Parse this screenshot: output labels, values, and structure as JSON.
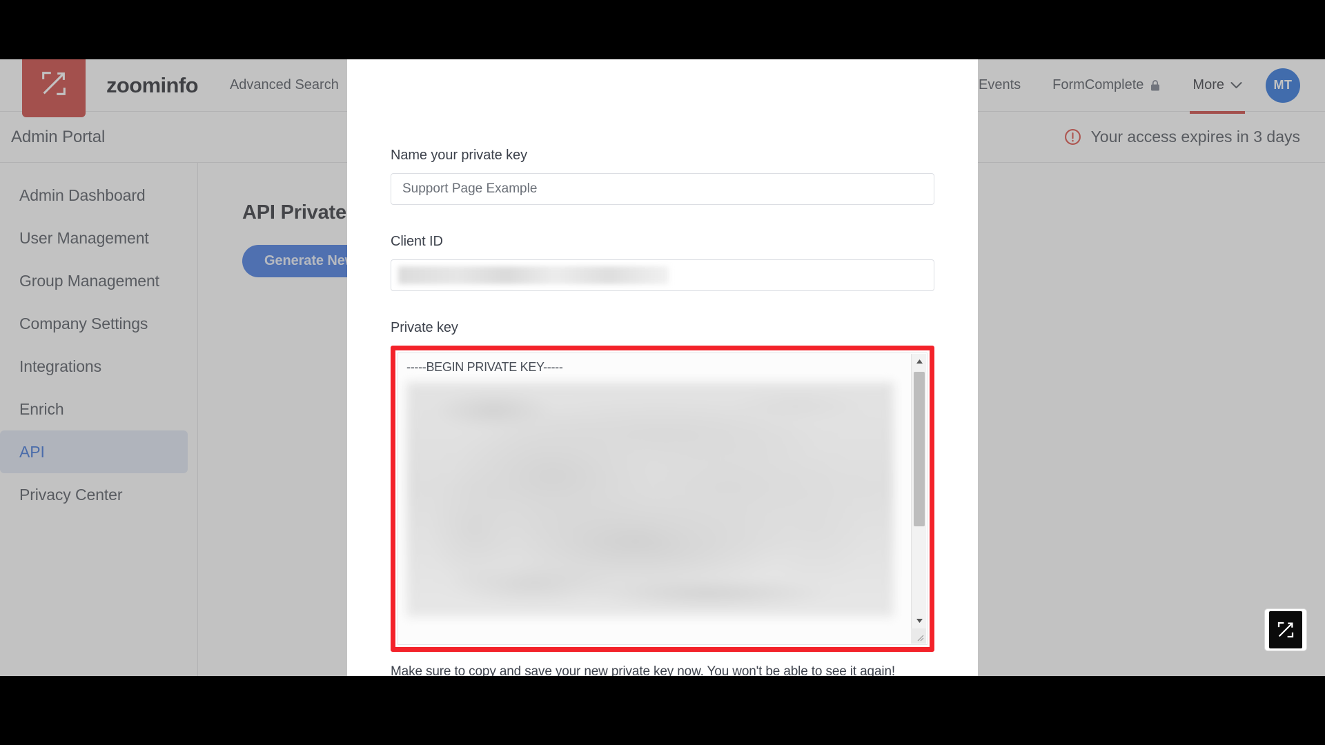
{
  "app": {
    "brand": "zoominfo",
    "logo_icon": "zoominfo-z-logo"
  },
  "topnav": {
    "links": [
      {
        "label": "Advanced Search",
        "icon": null,
        "active": false
      },
      {
        "label": "Events",
        "icon": null,
        "active": false
      },
      {
        "label": "FormComplete",
        "icon": "lock-icon",
        "active": false
      },
      {
        "label": "More",
        "icon": "chevron-down-icon",
        "active": true
      }
    ],
    "avatar_initials": "MT"
  },
  "portalbar": {
    "title": "Admin Portal",
    "expiry_icon": "alert-circle-icon",
    "expiry_text": "Your access expires in 3 days"
  },
  "sidebar": {
    "items": [
      {
        "label": "Admin Dashboard",
        "selected": false
      },
      {
        "label": "User Management",
        "selected": false
      },
      {
        "label": "Group Management",
        "selected": false
      },
      {
        "label": "Company Settings",
        "selected": false
      },
      {
        "label": "Integrations",
        "selected": false
      },
      {
        "label": "Enrich",
        "selected": false
      },
      {
        "label": "API",
        "selected": true
      },
      {
        "label": "Privacy Center",
        "selected": false
      }
    ]
  },
  "content": {
    "heading": "API Private Keys",
    "generate_button": "Generate New"
  },
  "modal": {
    "name_label": "Name your private key",
    "name_value": "Support Page Example",
    "name_placeholder": "Name your private key",
    "client_id_label": "Client ID",
    "client_id_value": "",
    "private_key_label": "Private key",
    "private_key_text": "-----BEGIN PRIVATE KEY-----",
    "note": "Make sure to copy and save your new private key now. You won't be able to see it again!"
  },
  "badge": {
    "icon": "zoominfo-z-logo"
  },
  "colors": {
    "brand_red": "#c7312b",
    "accent_blue": "#2f6ade",
    "avatar_blue": "#1463d8",
    "highlight_red": "#f3222a",
    "selected_item_bg": "#dfe6f5",
    "selected_item_text": "#2563d4",
    "warning_red": "#d9372e"
  }
}
